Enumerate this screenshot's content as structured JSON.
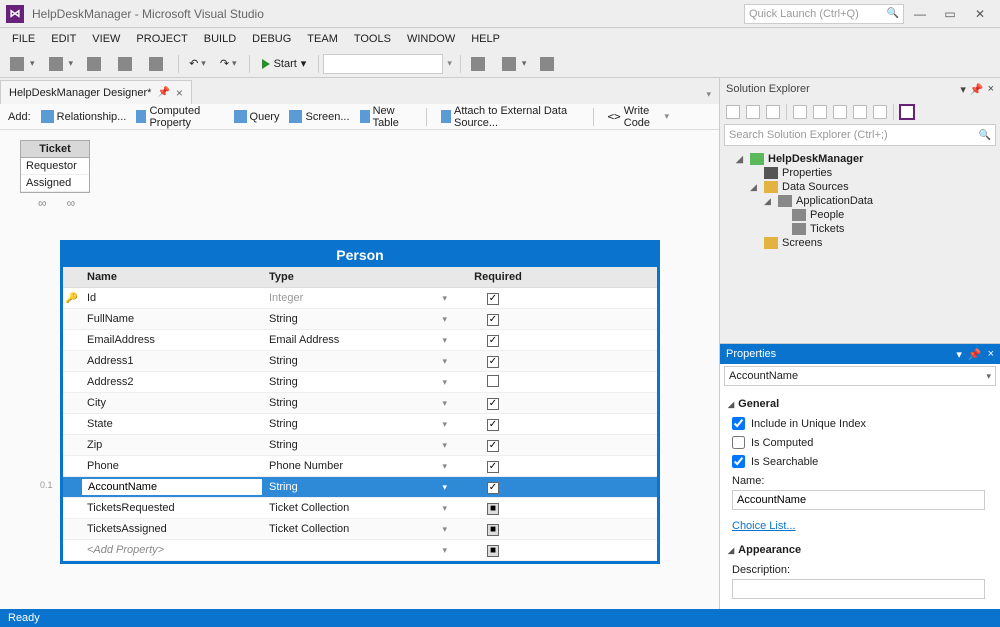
{
  "title": "HelpDeskManager - Microsoft Visual Studio",
  "quick_launch_placeholder": "Quick Launch (Ctrl+Q)",
  "menus": [
    "FILE",
    "EDIT",
    "VIEW",
    "PROJECT",
    "BUILD",
    "DEBUG",
    "TEAM",
    "TOOLS",
    "WINDOW",
    "HELP"
  ],
  "start_label": "Start",
  "doc_tab": "HelpDeskManager Designer*",
  "designer": {
    "add_label": "Add:",
    "items": [
      "Relationship...",
      "Computed Property",
      "Query",
      "Screen...",
      "New Table"
    ],
    "attach": "Attach to External Data Source...",
    "write_code": "Write Code"
  },
  "ticket": {
    "title": "Ticket",
    "rows": [
      "Requestor",
      "Assigned"
    ]
  },
  "ruler_mark": "0.1",
  "person": {
    "title": "Person",
    "headers": {
      "name": "Name",
      "type": "Type",
      "req": "Required"
    },
    "rows": [
      {
        "name": "Id",
        "type": "Integer",
        "req": "checked",
        "key": true,
        "dim": true
      },
      {
        "name": "FullName",
        "type": "String",
        "req": "checked"
      },
      {
        "name": "EmailAddress",
        "type": "Email Address",
        "req": "checked"
      },
      {
        "name": "Address1",
        "type": "String",
        "req": "checked"
      },
      {
        "name": "Address2",
        "type": "String",
        "req": "unchecked"
      },
      {
        "name": "City",
        "type": "String",
        "req": "checked"
      },
      {
        "name": "State",
        "type": "String",
        "req": "checked"
      },
      {
        "name": "Zip",
        "type": "String",
        "req": "checked"
      },
      {
        "name": "Phone",
        "type": "Phone Number",
        "req": "checked"
      },
      {
        "name": "AccountName",
        "type": "String",
        "req": "checked",
        "selected": true
      },
      {
        "name": "TicketsRequested",
        "type": "Ticket Collection",
        "req": "mixed"
      },
      {
        "name": "TicketsAssigned",
        "type": "Ticket Collection",
        "req": "mixed"
      },
      {
        "name": "<Add Property>",
        "type": "",
        "req": "mixed",
        "italic": true
      }
    ]
  },
  "solution_explorer": {
    "title": "Solution Explorer",
    "search_placeholder": "Search Solution Explorer (Ctrl+;)",
    "project": "HelpDeskManager",
    "properties": "Properties",
    "data_sources": "Data Sources",
    "app_data": "ApplicationData",
    "tables": [
      "People",
      "Tickets"
    ],
    "screens": "Screens"
  },
  "properties": {
    "title": "Properties",
    "context": "AccountName",
    "general": "General",
    "include_unique": "Include in Unique Index",
    "is_computed": "Is Computed",
    "is_searchable": "Is Searchable",
    "name_label": "Name:",
    "name_value": "AccountName",
    "choice_list": "Choice List...",
    "appearance": "Appearance",
    "description": "Description:",
    "include_unique_checked": true,
    "is_computed_checked": false,
    "is_searchable_checked": true
  },
  "status": "Ready"
}
